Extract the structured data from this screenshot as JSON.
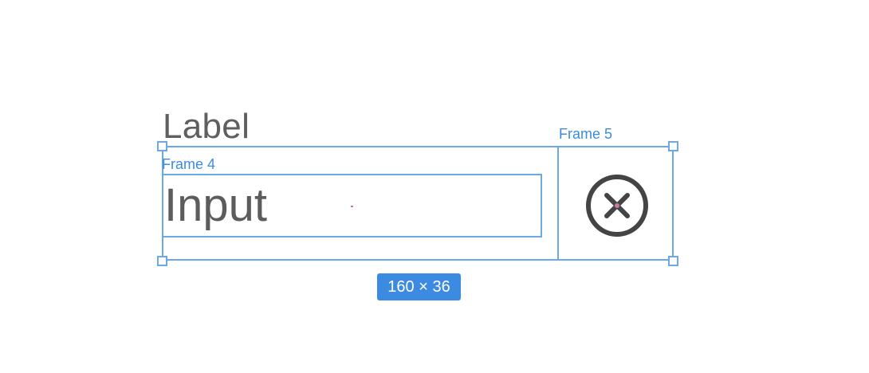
{
  "canvas": {
    "label": "Label",
    "input_value": "Input"
  },
  "frames": {
    "frame4_name": "Frame 4",
    "frame5_name": "Frame 5"
  },
  "selection": {
    "size_badge": "160 × 36"
  },
  "icons": {
    "clear": "close-circle-icon"
  },
  "colors": {
    "selection_blue": "#6aa8e8",
    "badge_blue": "#3d8be0",
    "text_gray": "#5f5f5f",
    "icon_dark": "#444444"
  }
}
